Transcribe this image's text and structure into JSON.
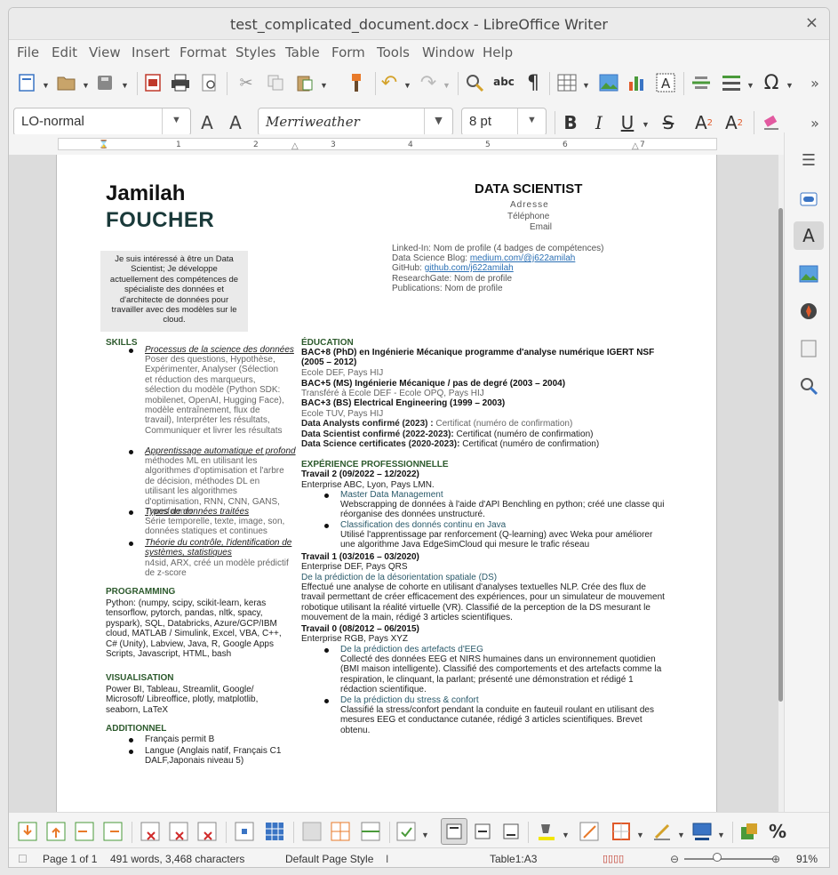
{
  "window": {
    "title": "test_complicated_document.docx - LibreOffice Writer",
    "close": "×"
  },
  "menu": [
    "File",
    "Edit",
    "View",
    "Insert",
    "Format",
    "Styles",
    "Table",
    "Form",
    "Tools",
    "Window",
    "Help"
  ],
  "format_bar": {
    "para_style": "LO-normal",
    "font_name": "Merriweather",
    "font_size": "8 pt"
  },
  "ruler_numbers": [
    "1",
    "1",
    "2",
    "3",
    "4",
    "5",
    "6",
    "7"
  ],
  "doc": {
    "first_name": "Jamilah",
    "last_name": "FOUCHER",
    "role": "DATA SCIENTIST",
    "address": "Adresse",
    "phone": "Téléphone",
    "email": "Email",
    "intro": "Je suis intéressé à être un Data Scientist; Je développe actuellement des compétences de spécialiste des données et d'architecte de données pour travailler avec des modèles sur le cloud.",
    "links": {
      "linkedin": "Linked-In: Nom de profile (4 badges de compétences)",
      "blog_label": "Data Science Blog: ",
      "blog_url": "medium.com/@j622amilah",
      "github_label": "GitHub: ",
      "github_url": "github.com/j622amilah",
      "researchgate": "ResearchGate: Nom de profile",
      "publications": "Publications: Nom de profile"
    },
    "skills_title": "SKILLS",
    "skills": [
      {
        "title": "Processus de la science des données",
        "text": "Poser des questions, Hypothèse, Expérimenter, Analyser (Sélection et réduction des marqueurs, sélection du modèle (Python SDK: mobilenet, OpenAI, Hugging Face), modèle entraînement, flux de travail), Interpréter les résultats, Communiquer et livrer les résultats"
      },
      {
        "title": "Apprentissage automatique et profond",
        "text": "méthodes ML en utilisant les algorithmes d'optimisation et l'arbre de décision, méthodes DL en utilisant les algorithmes d'optimisation, RNN, CNN, GANS, Transformer"
      },
      {
        "title": "Types de données traitées",
        "text": "Série temporelle, texte, image, son, données statiques et continues"
      },
      {
        "title": "Théorie du contrôle, l'identification de systèmes, statistiques",
        "text": "n4sid, ARX, créé un modèle prédictif de z-score"
      }
    ],
    "programming_title": "PROGRAMMING",
    "programming": "Python: (numpy, scipy, scikit-learn, keras tensorflow, pytorch, pandas, nltk, spacy, pyspark), SQL, Databricks, Azure/GCP/IBM cloud, MATLAB / Simulink, Excel, VBA, C++, C# (Unity), Labview, Java, R, Google Apps Scripts, Javascript, HTML, bash",
    "visual_title": "VISUALISATION",
    "visual": "Power BI, Tableau, Streamlit, Google/ Microsoft/ Libreoffice, plotly, matplotlib, seaborn, LaTeX",
    "extra_title": "ADDITIONNEL",
    "extra": [
      "Français permit B",
      "Langue (Anglais natif, Français C1 DALF,Japonais niveau 5)"
    ],
    "education_title": "ÉDUCATION",
    "education": [
      {
        "bold": "BAC+8 (PhD) en Ingénierie Mécanique programme d'analyse numérique IGERT NSF  (2005 – 2012)",
        "grey": "Ecole DEF, Pays HIJ"
      },
      {
        "bold": "BAC+5 (MS) Ingénierie Mécanique / pas de degré (2003 – 2004)",
        "grey": "Transféré à Ecole DEF - Ecole OPQ, Pays HIJ"
      },
      {
        "bold": "BAC+3 (BS) Electrical Engineering (1999 – 2003)",
        "grey": "Ecole TUV, Pays HIJ"
      }
    ],
    "certs": [
      {
        "bold": "Data Analysts confirmé (2023) : ",
        "rest": "Certificat (numéro de confirmation)"
      },
      {
        "bold": "Data Scientist confirmé (2022-2023): ",
        "rest": "Certificat (numéro de confirmation)"
      },
      {
        "bold": "Data Science certificates (2020-2023): ",
        "rest": "Certificat (numéro de confirmation)"
      }
    ],
    "exp_title": "EXPÉRIENCE PROFESSIONNELLE",
    "jobs": {
      "j2_title": "Travail 2 (09/2022 – 12/2022)",
      "j2_company": "Enterprise ABC, Lyon, Pays LMN.",
      "j2_items": [
        {
          "sub": "Master Data Management",
          "text": "Webscrapping de données à l'aide d'API Benchling en python; créé une classe qui réorganise des données unstructuré."
        },
        {
          "sub": "Classification des donnés continu en Java",
          "text": "Utilisé l'apprentissage par renforcement (Q-learning) avec Weka pour améliorer une algorithme Java EdgeSimCloud qui mesure le trafic réseau"
        }
      ],
      "j1_title": "Travail 1 (03/2016 – 03/2020)",
      "j1_company": "Enterprise DEF, Pays QRS",
      "j1_sub": "De la prédiction de la désorientation spatiale (DS)",
      "j1_text": "Effectué une analyse de cohorte en utilisant d'analyses textuelles NLP. Crée des flux de travail permettant de créer efficacement des expériences, pour un simulateur de mouvement robotique utilisant la réalité virtuelle (VR). Classifié de la perception de la DS mesurant le mouvement de la main, rédigé 3 articles scientifiques.",
      "j0_title": "Travail 0 (08/2012 – 06/2015)",
      "j0_company": "Enterprise RGB, Pays XYZ",
      "j0_items": [
        {
          "sub": "De la prédiction des artefacts d'EEG",
          "text": "Collecté des données EEG et NIRS humaines dans un environnement quotidien (BMI maison intelligente). Classifié des comportements et des artefacts comme la respiration, le clinquant, la parlant; présenté une démonstration et rédigé 1 rédaction scientifique."
        },
        {
          "sub": "De la prédiction du stress & confort",
          "text": "Classifié la stress/confort pendant la conduite en fauteuil roulant en utilisant des mesures EEG et conductance cutanée, rédigé 3 articles scientifiques. Brevet obtenu."
        }
      ]
    }
  },
  "status": {
    "page": "Page 1 of 1",
    "words": "491 words, 3,468 characters",
    "style": "Default Page Style",
    "cell": "Table1:A3",
    "zoom": "91%"
  }
}
